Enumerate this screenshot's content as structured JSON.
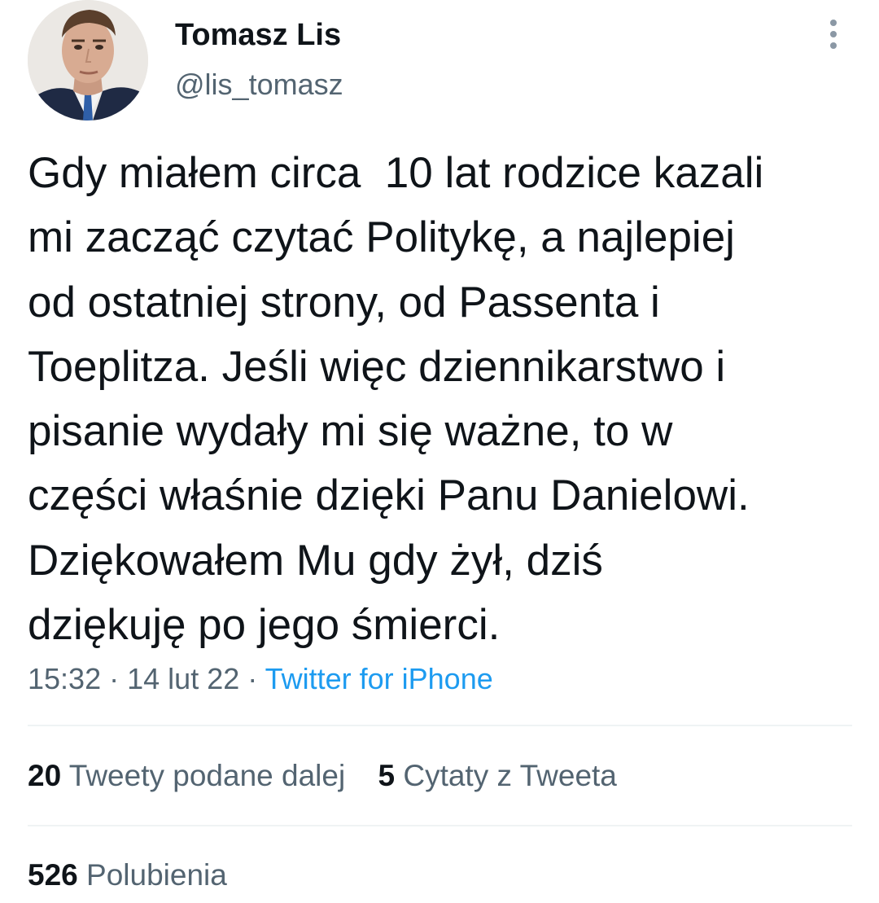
{
  "author": {
    "name": "Tomasz Lis",
    "handle": "@lis_tomasz"
  },
  "tweet": {
    "text": "Gdy miałem circa  10 lat rodzice kazali\nmi zacząć czytać Politykę, a najlepiej\nod ostatniej strony, od Passenta i\nToeplitza. Jeśli więc dziennikarstwo i\npisanie wydały mi się ważne, to w\nczęści właśnie dzięki Panu Danielowi.\nDziękowałem Mu gdy żył, dziś\ndziękuję po jego śmierci.",
    "time": "15:32",
    "date": "14 lut 22",
    "separator": "·",
    "source": "Twitter for iPhone"
  },
  "stats": {
    "retweets": {
      "count": "20",
      "label": "Tweety podane dalej"
    },
    "quotes": {
      "count": "5",
      "label": "Cytaty z Tweeta"
    },
    "likes": {
      "count": "526",
      "label": "Polubienia"
    }
  },
  "icons": {
    "more": "more-vertical-icon"
  },
  "colors": {
    "text": "#0f1419",
    "secondary": "#536471",
    "link": "#1d9bf0",
    "divider": "#eff3f4"
  }
}
